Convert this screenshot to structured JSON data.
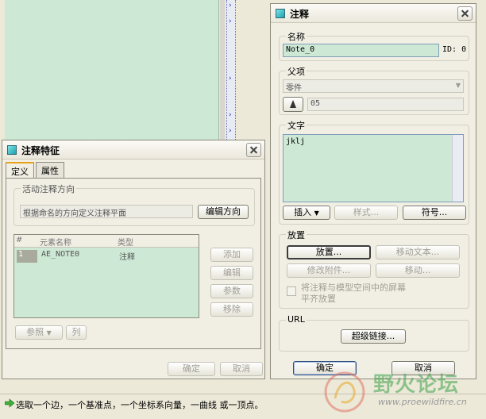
{
  "note_dialog": {
    "title": "注释",
    "name_group": "名称",
    "name_value": "Note_0",
    "id_label": "ID: 0",
    "parent_group": "父项",
    "parent_type": "零件",
    "parent_ref": "05",
    "text_group": "文字",
    "text_value": "jklj",
    "insert_label": "插入",
    "style_label": "样式...",
    "symbol_label": "符号...",
    "placement_group": "放置",
    "place_label": "放置...",
    "move_text_label": "移动文本...",
    "modify_attach_label": "修改附件...",
    "move_label": "移动...",
    "align_checkbox_label_line1": "将注释与模型空间中的屏幕",
    "align_checkbox_label_line2": "平齐放置",
    "url_group": "URL",
    "hyperlink_label": "超级链接...",
    "ok_label": "确定",
    "cancel_label": "取消"
  },
  "feature_dialog": {
    "title": "注释特征",
    "tabs": [
      {
        "label": "定义"
      },
      {
        "label": "属性"
      }
    ],
    "orientation_group": "活动注释方向",
    "orientation_value": "根据命名的方向定义注释平面",
    "edit_orientation_label": "编辑方向",
    "table": {
      "headers": [
        "#",
        "元素名称",
        "类型"
      ],
      "rows": [
        {
          "index": "1",
          "name": "AE_NOTE0",
          "type": "注释"
        }
      ]
    },
    "add_label": "添加",
    "edit_label": "编辑",
    "params_label": "参数",
    "remove_label": "移除",
    "reference_label": "参照",
    "columns_label": "列",
    "ok_label": "确定",
    "cancel_label": "取消"
  },
  "status_bar": {
    "message": "选取一个边，一个基准点，一个坐标系向量，一曲线 或一顶点。"
  },
  "watermark": {
    "main": "野火论坛",
    "url": "www.proewildfire.cn"
  },
  "colors": {
    "panel_green": "#cde8d4",
    "dialog_bg": "#f1efe4",
    "accent_orange": "#e8a21a"
  }
}
